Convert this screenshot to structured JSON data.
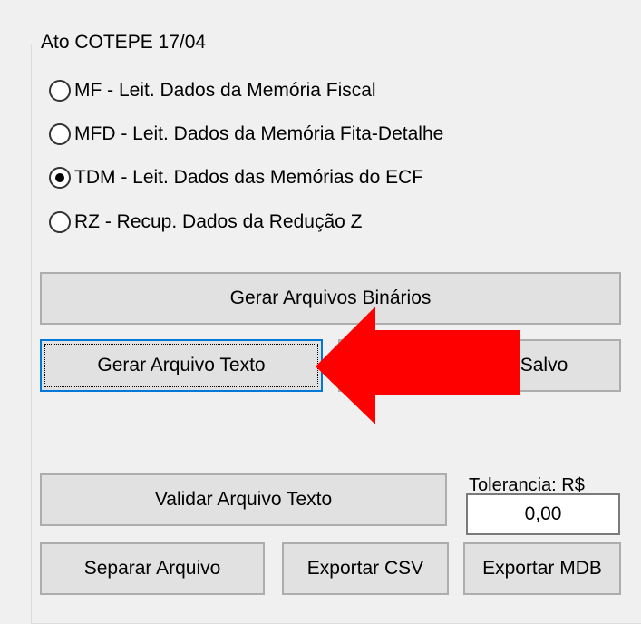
{
  "group": {
    "title": "Ato COTEPE 17/04"
  },
  "radios": [
    {
      "label": "MF - Leit. Dados da Memória Fiscal",
      "checked": false
    },
    {
      "label": "MFD - Leit. Dados da Memória Fita-Detalhe",
      "checked": false
    },
    {
      "label": "TDM - Leit. Dados das Memórias do ECF",
      "checked": true
    },
    {
      "label": "RZ - Recup. Dados da Redução Z",
      "checked": false
    }
  ],
  "buttons": {
    "gerar_binarios": "Gerar Arquivos Binários",
    "gerar_texto": "Gerar Arquivo Texto",
    "salvo": "Salvo",
    "validar_texto": "Validar Arquivo Texto",
    "separar": "Separar Arquivo",
    "exportar_csv": "Exportar CSV",
    "exportar_mdb": "Exportar MDB"
  },
  "tolerancia": {
    "label": "Tolerancia: R$",
    "value": "0,00"
  },
  "colors": {
    "arrow": "#ff0000",
    "focus_border": "#0078d7"
  },
  "annotation": {
    "icon": "red-arrow-icon"
  }
}
